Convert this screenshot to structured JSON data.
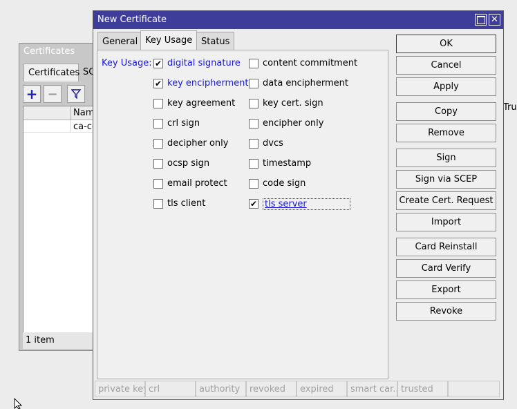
{
  "background_window": {
    "title": "Certificates",
    "tabs": [
      "Certificates",
      "SC"
    ],
    "column_name": "Nam",
    "column_trust": "Tru",
    "row_name": "ca-ce",
    "status": "1 item"
  },
  "dialog": {
    "title": "New Certificate",
    "tabs": [
      "General",
      "Key Usage",
      "Status"
    ],
    "key_usage_label": "Key Usage:",
    "left_options": [
      {
        "label": "digital signature",
        "checked": true
      },
      {
        "label": "key encipherment",
        "checked": true
      },
      {
        "label": "key agreement",
        "checked": false
      },
      {
        "label": "crl sign",
        "checked": false
      },
      {
        "label": "decipher only",
        "checked": false
      },
      {
        "label": "ocsp sign",
        "checked": false
      },
      {
        "label": "email protect",
        "checked": false
      },
      {
        "label": "tls client",
        "checked": false
      }
    ],
    "right_options": [
      {
        "label": "content commitment",
        "checked": false
      },
      {
        "label": "data encipherment",
        "checked": false
      },
      {
        "label": "key cert. sign",
        "checked": false
      },
      {
        "label": "encipher only",
        "checked": false
      },
      {
        "label": "dvcs",
        "checked": false
      },
      {
        "label": "timestamp",
        "checked": false
      },
      {
        "label": "code sign",
        "checked": false
      },
      {
        "label": "tls server",
        "checked": true
      }
    ],
    "buttons": [
      "OK",
      "Cancel",
      "Apply",
      "Copy",
      "Remove",
      "Sign",
      "Sign via SCEP",
      "Create Cert. Request",
      "Import",
      "Card Reinstall",
      "Card Verify",
      "Export",
      "Revoke"
    ],
    "status_fields": [
      "private key",
      "crl",
      "authority",
      "revoked",
      "expired",
      "smart car...",
      "trusted",
      ""
    ]
  }
}
